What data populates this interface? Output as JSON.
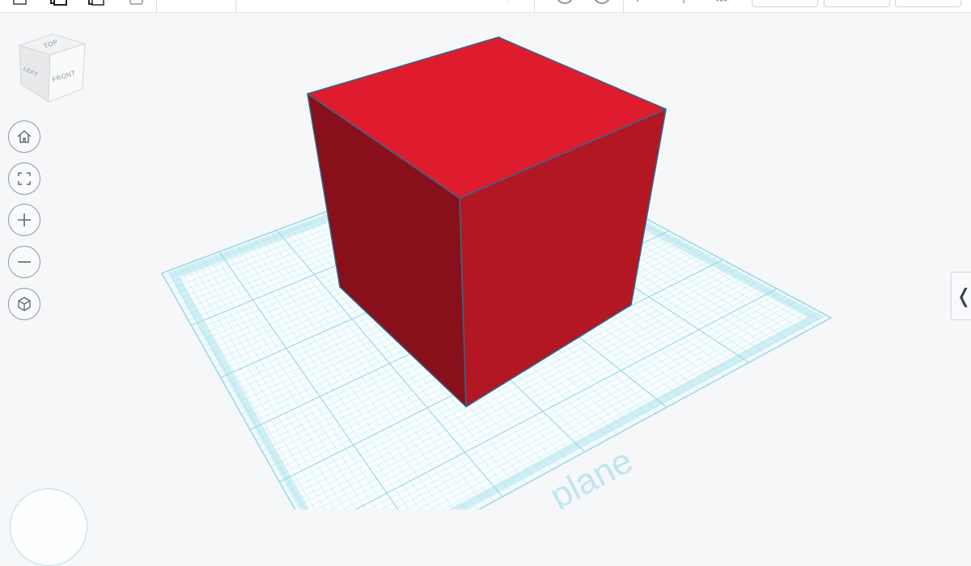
{
  "toolbar": {
    "buttons": [
      {
        "name": "new-shape-icon"
      },
      {
        "name": "copy-icon"
      },
      {
        "name": "paste-icon"
      },
      {
        "name": "delete-icon"
      },
      {
        "name": "light-bulb-icon"
      },
      {
        "name": "undo-icon"
      },
      {
        "name": "redo-icon"
      },
      {
        "name": "align-icon"
      },
      {
        "name": "mirror-icon"
      },
      {
        "name": "group-icon"
      }
    ],
    "pills": [
      "import-button",
      "export-button",
      "share-button"
    ]
  },
  "viewcube": {
    "top_label": "TOP",
    "left_label": "LEFT",
    "front_label": "FRONT"
  },
  "nav_controls": [
    {
      "name": "home-view-button",
      "icon": "home-icon"
    },
    {
      "name": "fit-view-button",
      "icon": "fit-to-view-icon"
    },
    {
      "name": "zoom-in-button",
      "icon": "plus-icon"
    },
    {
      "name": "zoom-out-button",
      "icon": "minus-icon"
    },
    {
      "name": "perspective-button",
      "icon": "cube-view-icon"
    }
  ],
  "workplane": {
    "label": "plane",
    "grid_color": "#8fd3e8",
    "fill_color": "#f2fbfd"
  },
  "shape": {
    "type": "box",
    "top_color": "#de1c2d",
    "left_color": "#87101b",
    "right_color": "#b21723",
    "edge_color": "#2f6b8a"
  },
  "right_panel_toggle": {
    "glyph": "❬"
  }
}
